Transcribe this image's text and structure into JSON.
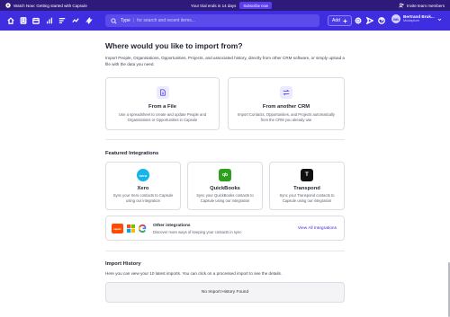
{
  "banner": {
    "watch_text": "Watch Now: Getting started with Capsule",
    "trial_text": "Your trial ends in 14 days",
    "subscribe_label": "Subscribe now",
    "invite_text": "Invite team members"
  },
  "nav": {
    "search_type_label": "Type",
    "search_placeholder": "for search and recent items...",
    "add_label": "Add",
    "user_name": "Bertrand Bruk...",
    "user_org": "Modaplore",
    "avatar_initials": "BB"
  },
  "main": {
    "title": "Where would you like to import from?",
    "intro": "Import People, Organisations, Opportunities, Projects, and associated history, directly from other CRM software, or simply upload a file with the data you need.",
    "cards": [
      {
        "title": "From a File",
        "desc": "Use a spreadsheet to create and update People and Organisations or Opportunities in Capsule"
      },
      {
        "title": "From another CRM",
        "desc": "Import Contacts, Opportunities, and Projects automatically from the CRM you already use"
      }
    ],
    "featured_title": "Featured Integrations",
    "integrations": [
      {
        "title": "Xero",
        "desc": "Sync your Xero contacts to Capsule using our integration",
        "logo_text": "xero",
        "color": "#13b5ea"
      },
      {
        "title": "QuickBooks",
        "desc": "Sync your QuickBooks contacts to Capsule using our integration",
        "logo_text": "qb",
        "color": "#2ca01c"
      },
      {
        "title": "Transpond",
        "desc": "Sync your Transpond contacts to Capsule using our integration",
        "logo_text": "T",
        "color": "#111111"
      }
    ],
    "other": {
      "title": "Other integrations",
      "desc": "Discover more ways of keeping your contacts in sync",
      "link": "View All Integrations",
      "logo_zapier": "zapier"
    },
    "history_title": "Import History",
    "history_text": "Here you can view your 10 latest imports. You can click on a processed import to see the details.",
    "history_empty": "No Import History Found"
  },
  "colors": {
    "banner_bg": "#2d1a7a",
    "nav_bg": "#3f2ee0",
    "accent": "#3f2ee0"
  }
}
